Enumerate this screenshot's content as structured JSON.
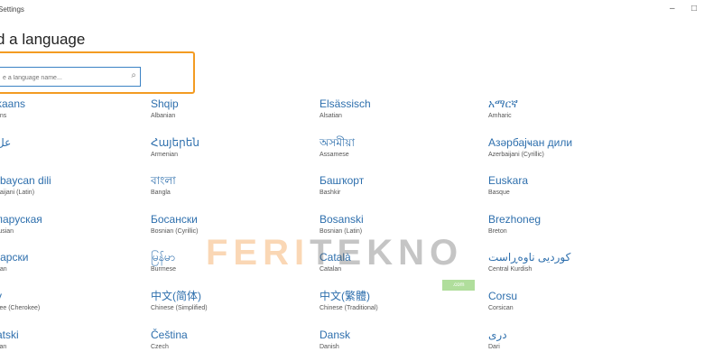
{
  "window": {
    "title": "Settings",
    "minimize_glyph": "–",
    "maximize_glyph": "□"
  },
  "page": {
    "heading": "d a language"
  },
  "search": {
    "placeholder": "e a language name...",
    "icon": "search-icon"
  },
  "languages": [
    {
      "native": "kaans",
      "english": "ans"
    },
    {
      "native": "Shqip",
      "english": "Albanian"
    },
    {
      "native": "Elsässisch",
      "english": "Alsatian"
    },
    {
      "native": "አማርኛ",
      "english": "Amharic"
    },
    {
      "native": "عل",
      "english": "c"
    },
    {
      "native": "Հայերեն",
      "english": "Armenian"
    },
    {
      "native": "অসমীয়া",
      "english": "Assamese"
    },
    {
      "native": "Азәрбајҹан дили",
      "english": "Azerbaijani (Cyrillic)"
    },
    {
      "native": "rbaycan dili",
      "english": "baijani (Latin)"
    },
    {
      "native": "বাংলা",
      "english": "Bangla"
    },
    {
      "native": "Башҡорт",
      "english": "Bashkir"
    },
    {
      "native": "Euskara",
      "english": "Basque"
    },
    {
      "native": "ларуская",
      "english": "rusian"
    },
    {
      "native": "Босански",
      "english": "Bosnian (Cyrillic)"
    },
    {
      "native": "Bosanski",
      "english": "Bosnian (Latin)"
    },
    {
      "native": "Brezhoneg",
      "english": "Breton"
    },
    {
      "native": "гарски",
      "english": "rian"
    },
    {
      "native": "မြန်မာ",
      "english": "Burmese"
    },
    {
      "native": "Català",
      "english": "Catalan"
    },
    {
      "native": "کوردیی ناوەڕاست",
      "english": "Central Kurdish"
    },
    {
      "native": "y",
      "english": "kee (Cherokee)"
    },
    {
      "native": "中文(简体)",
      "english": "Chinese (Simplified)"
    },
    {
      "native": "中文(繁體)",
      "english": "Chinese (Traditional)"
    },
    {
      "native": "Corsu",
      "english": "Corsican"
    },
    {
      "native": "atski",
      "english": "tian"
    },
    {
      "native": "Čeština",
      "english": "Czech"
    },
    {
      "native": "Dansk",
      "english": "Danish"
    },
    {
      "native": "درى",
      "english": "Dari"
    }
  ],
  "watermark": {
    "part1": "FERI",
    "part2": "TEKNO",
    "sub": ".com"
  }
}
